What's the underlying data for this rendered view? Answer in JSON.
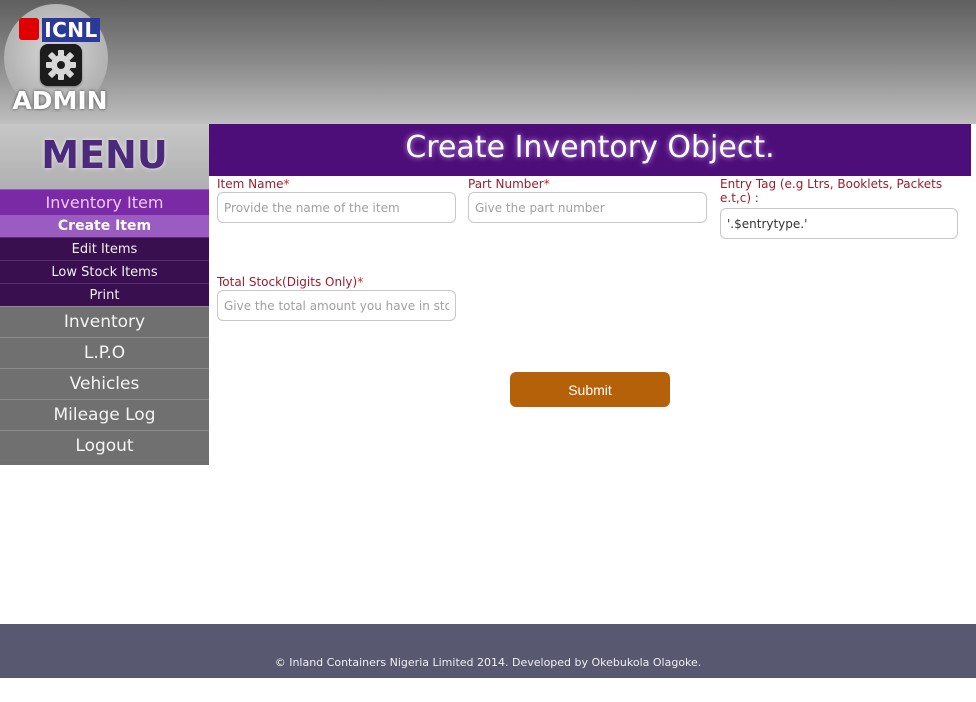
{
  "logo": {
    "brand": "ICNL",
    "label": "ADMIN",
    "icon": "gear-icon"
  },
  "sidebar": {
    "menu_title": "MENU",
    "section": "Inventory Item",
    "sub_items": [
      {
        "label": "Create Item",
        "active": true
      },
      {
        "label": "Edit Items"
      },
      {
        "label": "Low Stock Items"
      },
      {
        "label": "Print"
      }
    ],
    "nav": [
      {
        "label": "Inventory"
      },
      {
        "label": "L.P.O"
      },
      {
        "label": "Vehicles"
      },
      {
        "label": "Mileage Log"
      },
      {
        "label": "Logout"
      }
    ]
  },
  "main": {
    "title": "Create Inventory Object.",
    "fields": {
      "item_name": {
        "label": "Item Name",
        "required": "*",
        "placeholder": "Provide the name of the item",
        "value": ""
      },
      "part_number": {
        "label": "Part Number",
        "required": "*",
        "placeholder": "Give the part number",
        "value": ""
      },
      "entry_tag": {
        "label": "Entry Tag (e.g Ltrs, Booklets, Packets e.t,c) :",
        "placeholder": "",
        "value": "'.$entrytype.'"
      },
      "total_stock": {
        "label": "Total Stock(Digits Only)",
        "required": "*",
        "placeholder": "Give the total amount you have in stock",
        "value": ""
      }
    },
    "submit_label": "Submit"
  },
  "footer": {
    "text": "© Inland Containers Nigeria Limited 2014. Developed by Okebukola Olagoke."
  },
  "colors": {
    "title_bar": "#4e0e7a",
    "section_head": "#7a2aa5",
    "submit": "#b5610a",
    "label": "#9b1d2d",
    "footer": "#585870"
  }
}
